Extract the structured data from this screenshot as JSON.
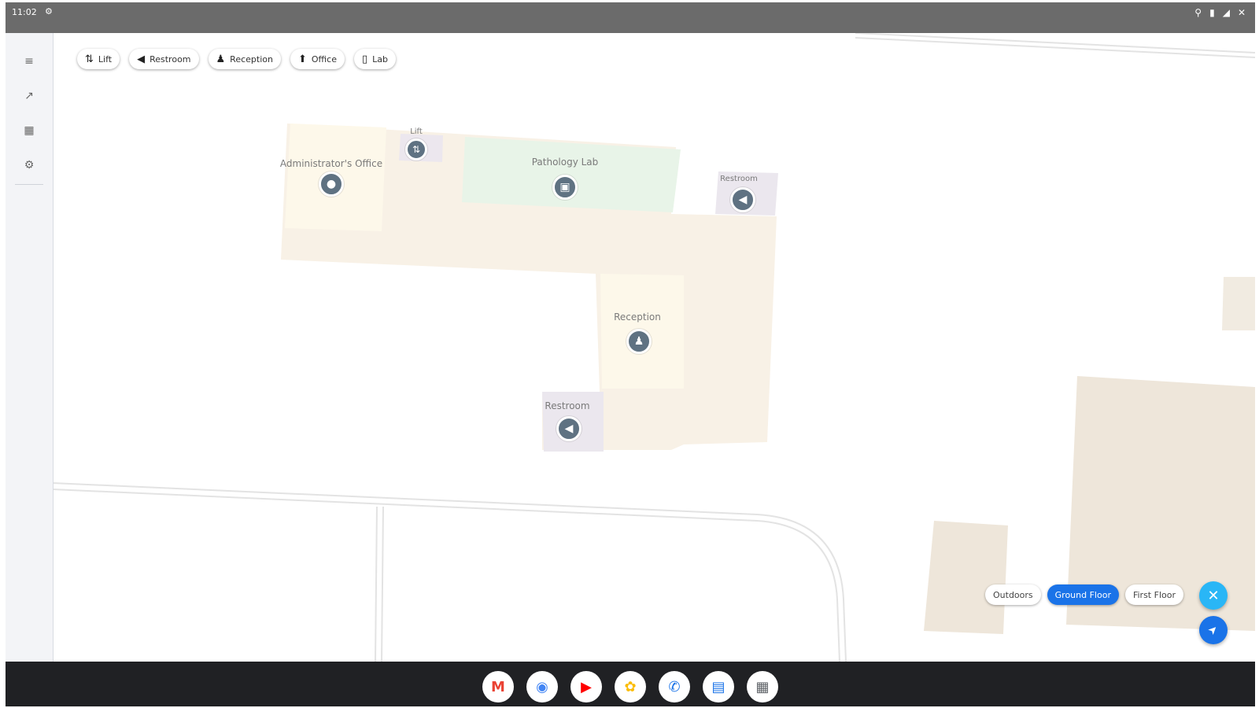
{
  "status_bar": {
    "time": "11:02",
    "indicator_icon": "settings-gear-icon",
    "right_icons": [
      "location-icon",
      "battery-icon",
      "signal-icon",
      "wifi-off-icon"
    ]
  },
  "sidebar": {
    "items": [
      {
        "icon": "menu-icon",
        "glyph": "≡"
      },
      {
        "icon": "directions-icon",
        "glyph": "↗"
      },
      {
        "icon": "building-icon",
        "glyph": "▦"
      },
      {
        "icon": "settings-icon",
        "glyph": "⚙"
      }
    ]
  },
  "category_chips": [
    {
      "label": "Lift",
      "icon": "lift-icon",
      "glyph": "⇅"
    },
    {
      "label": "Restroom",
      "icon": "restroom-icon",
      "glyph": "◀"
    },
    {
      "label": "Reception",
      "icon": "reception-icon",
      "glyph": "♟"
    },
    {
      "label": "Office",
      "icon": "office-icon",
      "glyph": "⬆"
    },
    {
      "label": "Lab",
      "icon": "lab-icon",
      "glyph": "▯"
    }
  ],
  "rooms": {
    "admin_office": {
      "label": "Administrator's Office",
      "icon": "office-icon",
      "glyph": "●"
    },
    "lift": {
      "label": "Lift",
      "icon": "lift-icon",
      "glyph": "⇅"
    },
    "pathology_lab": {
      "label": "Pathology Lab",
      "icon": "lab-icon",
      "glyph": "▣"
    },
    "restroom_1": {
      "label": "Restroom",
      "icon": "restroom-icon",
      "glyph": "◀"
    },
    "reception": {
      "label": "Reception",
      "icon": "reception-icon",
      "glyph": "♟"
    },
    "restroom_2": {
      "label": "Restroom",
      "icon": "restroom-icon",
      "glyph": "◀"
    }
  },
  "floor_selector": {
    "floors": [
      "Outdoors",
      "Ground Floor",
      "First Floor"
    ],
    "selected": "Ground Floor"
  },
  "fabs": {
    "close": {
      "icon": "close-icon",
      "glyph": "✕"
    },
    "navigate": {
      "icon": "navigation-arrow-icon",
      "glyph": "➤"
    }
  },
  "dock": [
    {
      "app": "gmail-icon",
      "glyph": "M",
      "color": "#ea4335"
    },
    {
      "app": "chrome-icon",
      "glyph": "◉",
      "color": "#4285f4"
    },
    {
      "app": "youtube-icon",
      "glyph": "▶",
      "color": "#ff0000"
    },
    {
      "app": "photos-icon",
      "glyph": "✿",
      "color": "#fbbc04"
    },
    {
      "app": "phone-icon",
      "glyph": "✆",
      "color": "#1a73e8"
    },
    {
      "app": "messages-icon",
      "glyph": "▤",
      "color": "#1a73e8"
    },
    {
      "app": "app-launcher-icon",
      "glyph": "▦",
      "color": "#5f6368"
    }
  ],
  "colors": {
    "corridor": "#f8f1e6",
    "office_fill": "#fdf8ea",
    "lab_fill": "#e8f4e8",
    "restroom_fill": "#ebe7ee",
    "accent": "#1a73e8"
  }
}
